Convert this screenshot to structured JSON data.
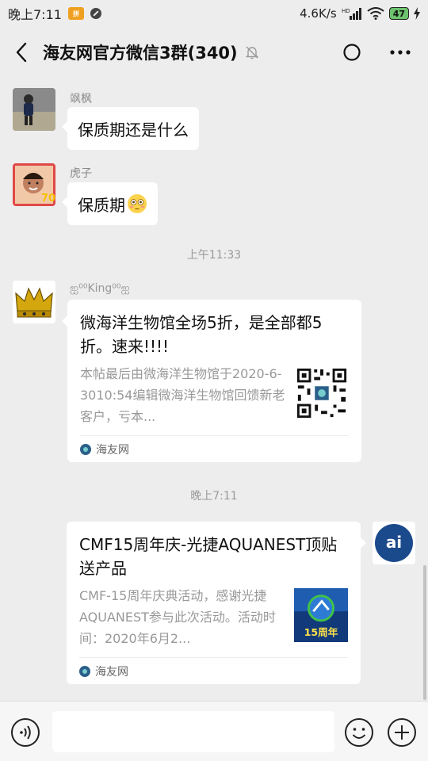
{
  "status_bar": {
    "time": "晚上7:11",
    "app_badge": "拼",
    "network_speed": "4.6K/s",
    "network_type": "HD",
    "battery": "47"
  },
  "header": {
    "title": "海友网官方微信3群(340)",
    "icons": [
      "back-icon",
      "mute-icon",
      "refresh-icon",
      "more-icon"
    ]
  },
  "messages": [
    {
      "type": "text",
      "sender": "飒枫",
      "text": "保质期还是什么"
    },
    {
      "type": "text",
      "sender": "虎子",
      "text": "保质期",
      "emoji": "flushed-face"
    }
  ],
  "time_divider_1": "上午11:33",
  "link_card_1": {
    "sender": "ஐ⁰⁰King⁰⁰ஐ",
    "title": "微海洋生物馆全场5折，是全部都5折。速来!!!!",
    "desc": "本帖最后由微海洋生物馆于2020-6-3010:54编辑微海洋生物馆回馈新老客户，亏本...",
    "source": "海友网",
    "thumb": "qr-code"
  },
  "time_divider_2": "晚上7:11",
  "link_card_2": {
    "title": "CMF15周年庆-光捷AQUANEST顶贴送产品",
    "desc": "CMF-15周年庆典活动，感谢光捷AQUANEST参与此次活动。活动时间：2020年6月2...",
    "source": "海友网",
    "thumb_text": "15周年"
  },
  "self_avatar_text": "ai",
  "input_bar": {
    "placeholder": ""
  },
  "colors": {
    "chat_bg": "#ededed",
    "bubble": "#ffffff",
    "meta_text": "#999999"
  }
}
